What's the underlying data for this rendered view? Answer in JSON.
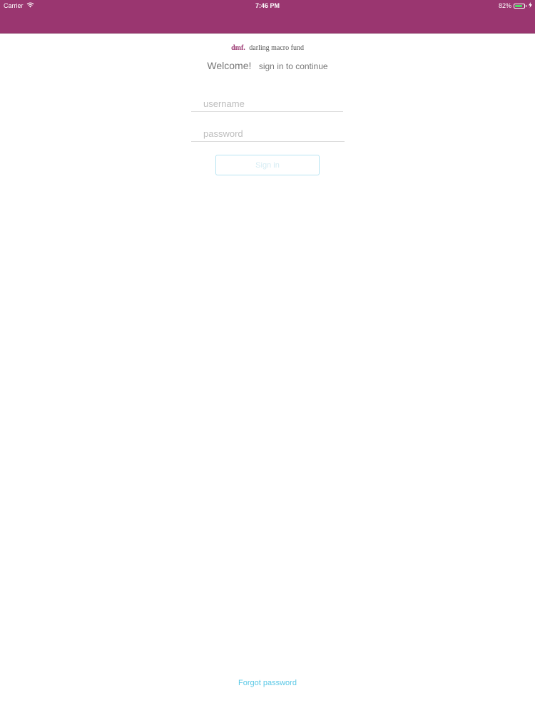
{
  "status_bar": {
    "carrier": "Carrier",
    "time": "7:46 PM",
    "battery": "82%",
    "battery_level": 0.82,
    "icons": [
      "wifi-icon",
      "battery-icon",
      "charging-icon"
    ]
  },
  "header": {
    "color": "#9a3670"
  },
  "brand": {
    "abbr": "dmf.",
    "name": "darling macro fund"
  },
  "welcome": {
    "title": "Welcome!",
    "subtitle": "sign in to continue"
  },
  "form": {
    "username": {
      "value": "",
      "placeholder": "username"
    },
    "password": {
      "value": "",
      "placeholder": "password"
    },
    "sign_in_label": "Sign in"
  },
  "footer": {
    "forgot_password": "Forgot password"
  },
  "colors": {
    "brand": "#9a3670",
    "link": "#5ac8e6",
    "button_border": "#b8e4f2",
    "battery": "#4cd964"
  }
}
